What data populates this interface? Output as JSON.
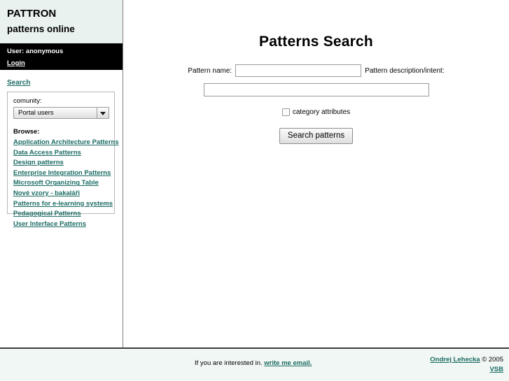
{
  "brand": {
    "line1": "PATTRON",
    "line2": "patterns online",
    "bg_color": "#e9f2ef"
  },
  "userbar": {
    "user_text": "User: anonymous",
    "login_label": "Login",
    "bg_color": "#000000"
  },
  "nav": {
    "search_label": "Search"
  },
  "panel": {
    "community_label": "comunity:",
    "community_selected": "Portal users",
    "community_options": [
      "Portal users"
    ],
    "browse_label": "Browse:",
    "browse_items": [
      {
        "label": "Application Architecture Patterns"
      },
      {
        "label": "Data Access Patterns"
      },
      {
        "label": "Design patterns"
      },
      {
        "label": "Enterprise Integration Patterns"
      },
      {
        "label": "Microsoft Organizing Table"
      },
      {
        "label": "Nové vzory - bakaláři"
      },
      {
        "label": "Patterns for e-learning systems"
      },
      {
        "label": "Pedagogical Patterns"
      },
      {
        "label": "User Interface Patterns"
      }
    ]
  },
  "main": {
    "title": "Patterns Search",
    "pattern_name_label": "Pattern name:",
    "pattern_name_value": "",
    "pattern_name_placeholder": "",
    "pattern_desc_label": "Pattern description/intent:",
    "pattern_desc_value": "",
    "pattern_desc_placeholder": "",
    "category_attributes_label": "category attributes",
    "category_attributes_checked": false,
    "search_button_label": "Search patterns"
  },
  "footer": {
    "left_text": "If you are interested in.",
    "left_link": "write me email.",
    "author_link": "Ondrej Lehecka",
    "copyright": "© 2005",
    "org_link": "VSB",
    "bg_color": "#f1f7f4"
  },
  "theme": {
    "link_color": "#1a6b63",
    "divider_color": "#808080"
  }
}
